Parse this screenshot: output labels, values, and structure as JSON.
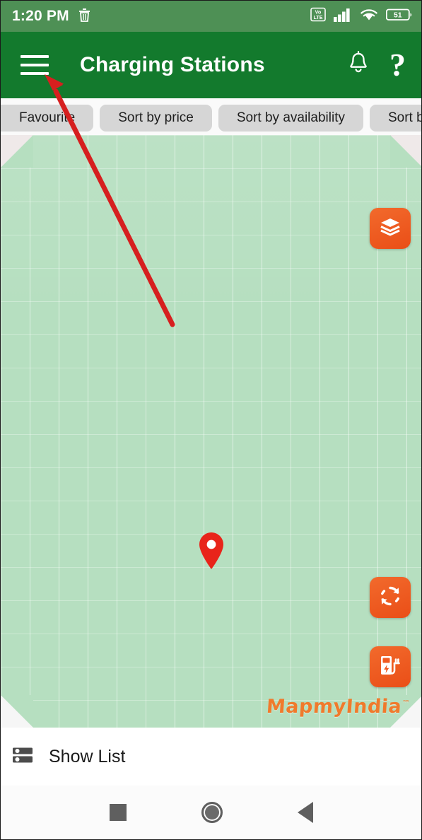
{
  "status_bar": {
    "time": "1:20 PM",
    "icons": {
      "trash": "trash-icon",
      "volte": "VoLTE",
      "volte_line1": "Vo",
      "volte_line2": "LTE",
      "signal": "signal-bars-icon",
      "wifi": "wifi-icon",
      "battery_level": "51"
    },
    "colors": {
      "background": "#4e9055",
      "foreground": "#ffffff"
    }
  },
  "app_bar": {
    "title": "Charging Stations",
    "menu_icon": "hamburger-menu-icon",
    "notification_icon": "bell-icon",
    "help_label": "?",
    "colors": {
      "background": "#137a2d",
      "foreground": "#ffffff"
    }
  },
  "filters": {
    "chips": [
      {
        "label": "Favourite"
      },
      {
        "label": "Sort by price"
      },
      {
        "label": "Sort by availability"
      },
      {
        "label": "Sort by rating"
      }
    ],
    "colors": {
      "chip_background": "#d6d6d6",
      "chip_text": "#1d1d1d"
    }
  },
  "map": {
    "watermark": "MapmyIndia",
    "watermark_trademark": "™",
    "marker": "map-pin-marker",
    "controls": [
      {
        "name": "layers-button",
        "icon": "layers-icon"
      },
      {
        "name": "refresh-button",
        "icon": "refresh-icon"
      },
      {
        "name": "charging-station-button",
        "icon": "ev-charging-station-icon"
      }
    ],
    "colors": {
      "map_background": "#b6dfc0",
      "control_background": "#f05a22",
      "marker": "#e8241a",
      "watermark": "#f07a2c"
    }
  },
  "annotation": {
    "type": "arrow",
    "color": "#d61f1f",
    "points_to": "hamburger-menu-icon"
  },
  "bottom_panel": {
    "show_list_label": "Show List",
    "show_list_icon": "list-storage-icon"
  },
  "nav_bar": {
    "recents": "square-recents-icon",
    "home": "circle-home-icon",
    "back": "triangle-back-icon",
    "color": "#5f5f5f"
  }
}
